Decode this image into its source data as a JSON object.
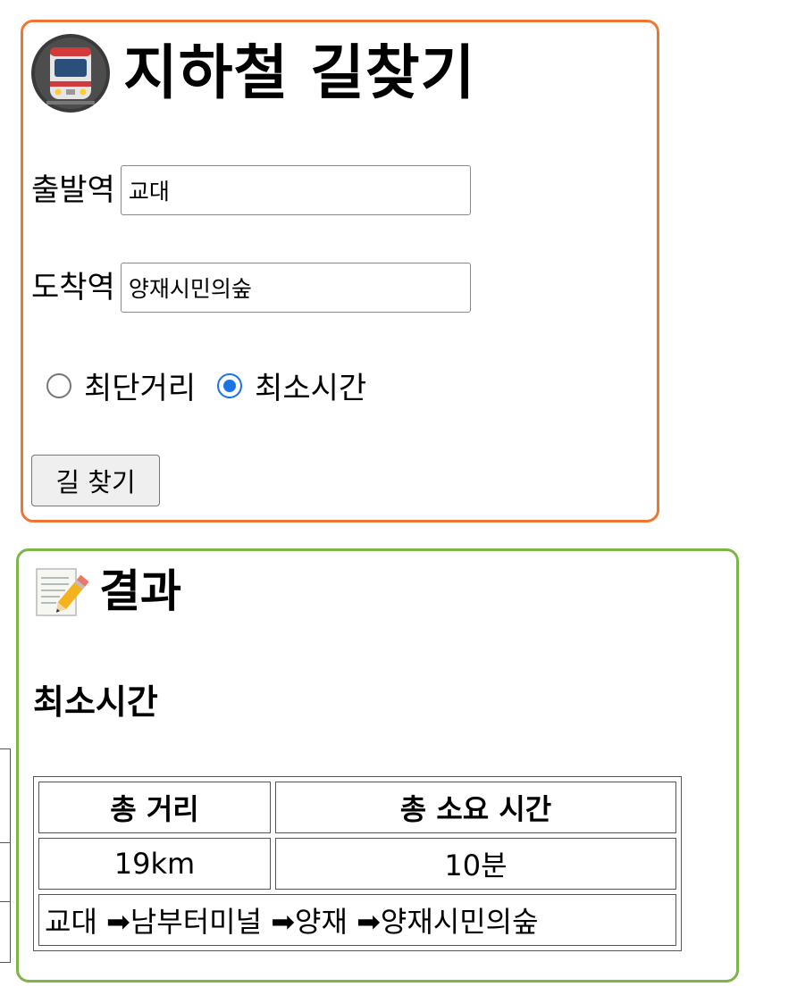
{
  "search": {
    "title": "지하철 길찾기",
    "title_icon": "metro-train-icon",
    "origin_label": "출발역",
    "origin_value": "교대",
    "destination_label": "도착역",
    "destination_value": "양재시민의숲",
    "options": [
      {
        "label": "최단거리",
        "checked": false
      },
      {
        "label": "최소시간",
        "checked": true
      }
    ],
    "submit_label": "길 찾기",
    "border_color": "#f07530"
  },
  "result": {
    "title": "결과",
    "title_icon": "memo-pencil-icon",
    "mode": "최소시간",
    "headers": [
      "총 거리",
      "총 소요 시간"
    ],
    "total_distance": "19km",
    "total_time": "10분",
    "route": "교대 ➡남부터미널 ➡양재 ➡양재시민의숲",
    "border_color": "#7db54a"
  },
  "colors": {
    "radio_selected": "#1a73e8"
  }
}
